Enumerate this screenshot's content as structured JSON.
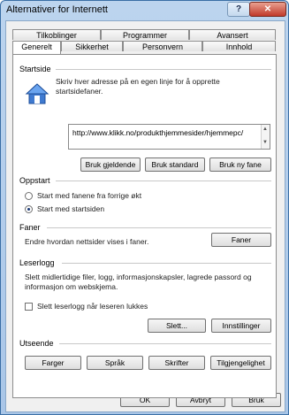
{
  "window": {
    "title": "Alternativer for Internett",
    "help_label": "?",
    "close_label": "✕"
  },
  "tabs_row1": [
    "Tilkoblinger",
    "Programmer",
    "Avansert"
  ],
  "tabs_row2": [
    "Generelt",
    "Sikkerhet",
    "Personvern",
    "Innhold"
  ],
  "active_tab": "Generelt",
  "startside": {
    "heading": "Startside",
    "description": "Skriv hver adresse på en egen linje for å opprette startsidefaner.",
    "url": "http://www.klikk.no/produkthjemmesider/hjemmepc/",
    "buttons": [
      "Bruk gjeldende",
      "Bruk standard",
      "Bruk ny fane"
    ],
    "icon": "house-icon"
  },
  "oppstart": {
    "heading": "Oppstart",
    "options": [
      "Start med fanene fra forrige økt",
      "Start med startsiden"
    ],
    "selected": "Start med startsiden"
  },
  "faner": {
    "heading": "Faner",
    "description": "Endre hvordan nettsider vises i faner.",
    "button": "Faner"
  },
  "leserlogg": {
    "heading": "Leserlogg",
    "description": "Slett midlertidige filer, logg, informasjonskapsler, lagrede passord og informasjon om webskjema.",
    "checkbox_label": "Slett leserlogg når leseren lukkes",
    "checked": false,
    "delete_button": "Slett...",
    "settings_button": "Innstillinger"
  },
  "utseende": {
    "heading": "Utseende",
    "buttons": [
      "Farger",
      "Språk",
      "Skrifter",
      "Tilgjengelighet"
    ]
  },
  "footer": {
    "ok": "OK",
    "cancel": "Avbryt",
    "apply": "Bruk"
  },
  "colors": {
    "title_bar": "#bcd4ee",
    "close_button": "#c0392b",
    "dialog_bg": "#f0f0f0"
  }
}
